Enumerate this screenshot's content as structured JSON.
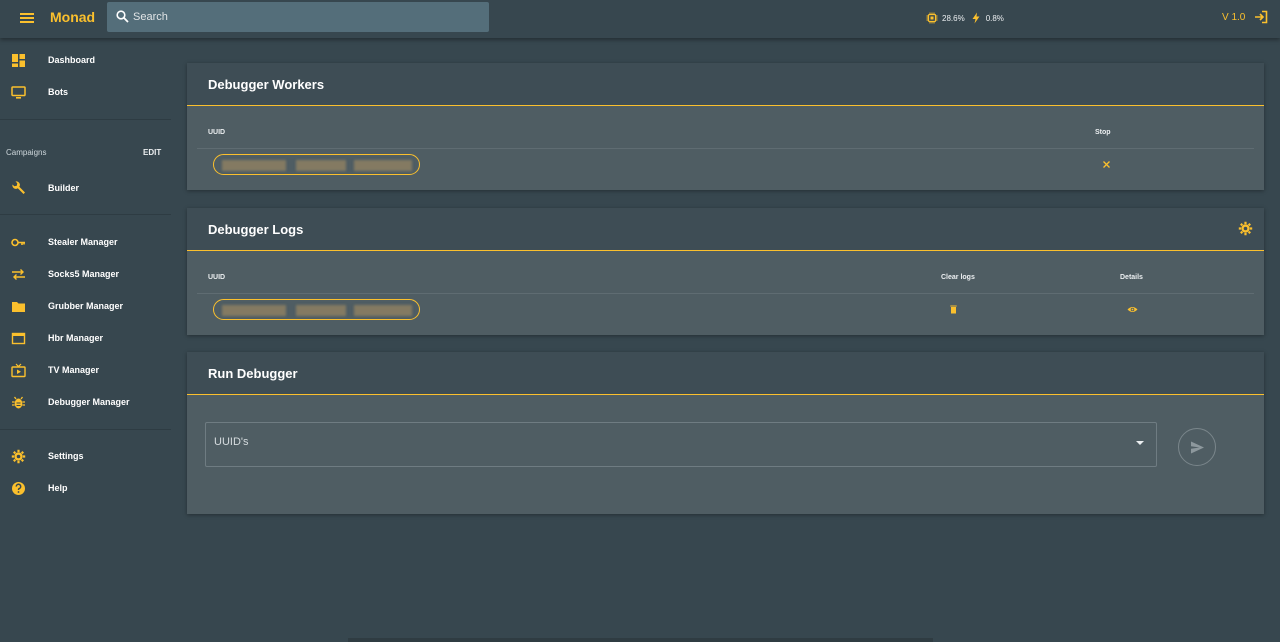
{
  "app": {
    "brand": "Monad",
    "version": "V 1.0"
  },
  "search": {
    "placeholder": "Search"
  },
  "stats": {
    "cpu": "28.6%",
    "power": "0.8%"
  },
  "sidebar": {
    "items_top": [
      {
        "label": "Dashboard",
        "icon": "dashboard-icon"
      },
      {
        "label": "Bots",
        "icon": "monitor-icon"
      }
    ],
    "campaigns_label": "Campaigns",
    "edit_label": "EDIT",
    "builder": {
      "label": "Builder",
      "icon": "wrench-icon"
    },
    "managers": [
      {
        "label": "Stealer Manager",
        "icon": "key-icon"
      },
      {
        "label": "Socks5 Manager",
        "icon": "swap-icon"
      },
      {
        "label": "Grubber Manager",
        "icon": "folder-icon"
      },
      {
        "label": "Hbr Manager",
        "icon": "window-icon"
      },
      {
        "label": "TV Manager",
        "icon": "tv-icon"
      },
      {
        "label": "Debugger Manager",
        "icon": "bug-icon"
      }
    ],
    "bottom": [
      {
        "label": "Settings",
        "icon": "gear-icon"
      },
      {
        "label": "Help",
        "icon": "help-icon"
      }
    ]
  },
  "workers": {
    "title": "Debugger Workers",
    "col_uuid": "UUID",
    "col_stop": "Stop"
  },
  "logs": {
    "title": "Debugger Logs",
    "col_uuid": "UUID",
    "col_clear": "Clear logs",
    "col_details": "Details"
  },
  "run": {
    "title": "Run Debugger",
    "select_placeholder": "UUID's"
  },
  "colors": {
    "accent": "#fbc02d",
    "background": "#37474f",
    "card": "#4f5d63",
    "card_header": "#3e4d55"
  }
}
